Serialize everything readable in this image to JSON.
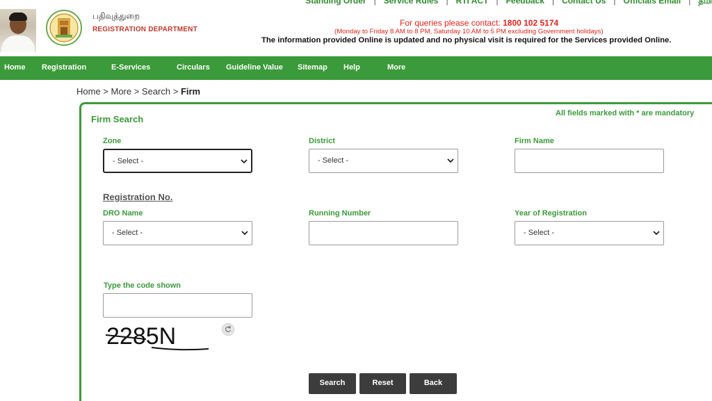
{
  "header": {
    "dept_tamil": "பதிவுத்துறை",
    "dept_english": "REGISTRATION DEPARTMENT",
    "top_links": [
      "Standing Order",
      "Service Rules",
      "RTI ACT",
      "Feedback",
      "Contact Us",
      "Officials Email",
      "தமி"
    ],
    "contact_label": "For queries please contact:",
    "contact_phone": "1800 102 5174",
    "hours": "(Monday to Friday 8 AM to 8 PM, Saturday 10 AM to 5 PM excluding Government holidays)",
    "info": "The information provided Online is updated and no physical visit is required for the Services provided Online."
  },
  "nav": [
    "Home",
    "Registration",
    "E-Services",
    "Circulars",
    "Guideline Value",
    "Sitemap",
    "Help",
    "More"
  ],
  "breadcrumb": {
    "path": "Home > More > Search > ",
    "current": "Firm"
  },
  "form": {
    "title": "Firm Search",
    "mandatory_note": "All fields marked with * are mandatory",
    "zone_label": "Zone",
    "zone_value": "- Select -",
    "district_label": "District",
    "district_value": "- Select -",
    "firm_name_label": "Firm Name",
    "firm_name_value": "",
    "registration_heading": "Registration No.",
    "dro_label": "DRO Name",
    "dro_value": "- Select -",
    "running_number_label": "Running Number",
    "running_number_value": "",
    "year_label": "Year of Registration",
    "year_value": "- Select -",
    "code_label": "Type the code shown",
    "code_value": "",
    "captcha_text": "2285N"
  },
  "buttons": {
    "search": "Search",
    "reset": "Reset",
    "back": "Back"
  },
  "colors": {
    "brand_green": "#3b9a39",
    "alert_red": "#e2231a",
    "button_dark": "#3c3c3c"
  }
}
